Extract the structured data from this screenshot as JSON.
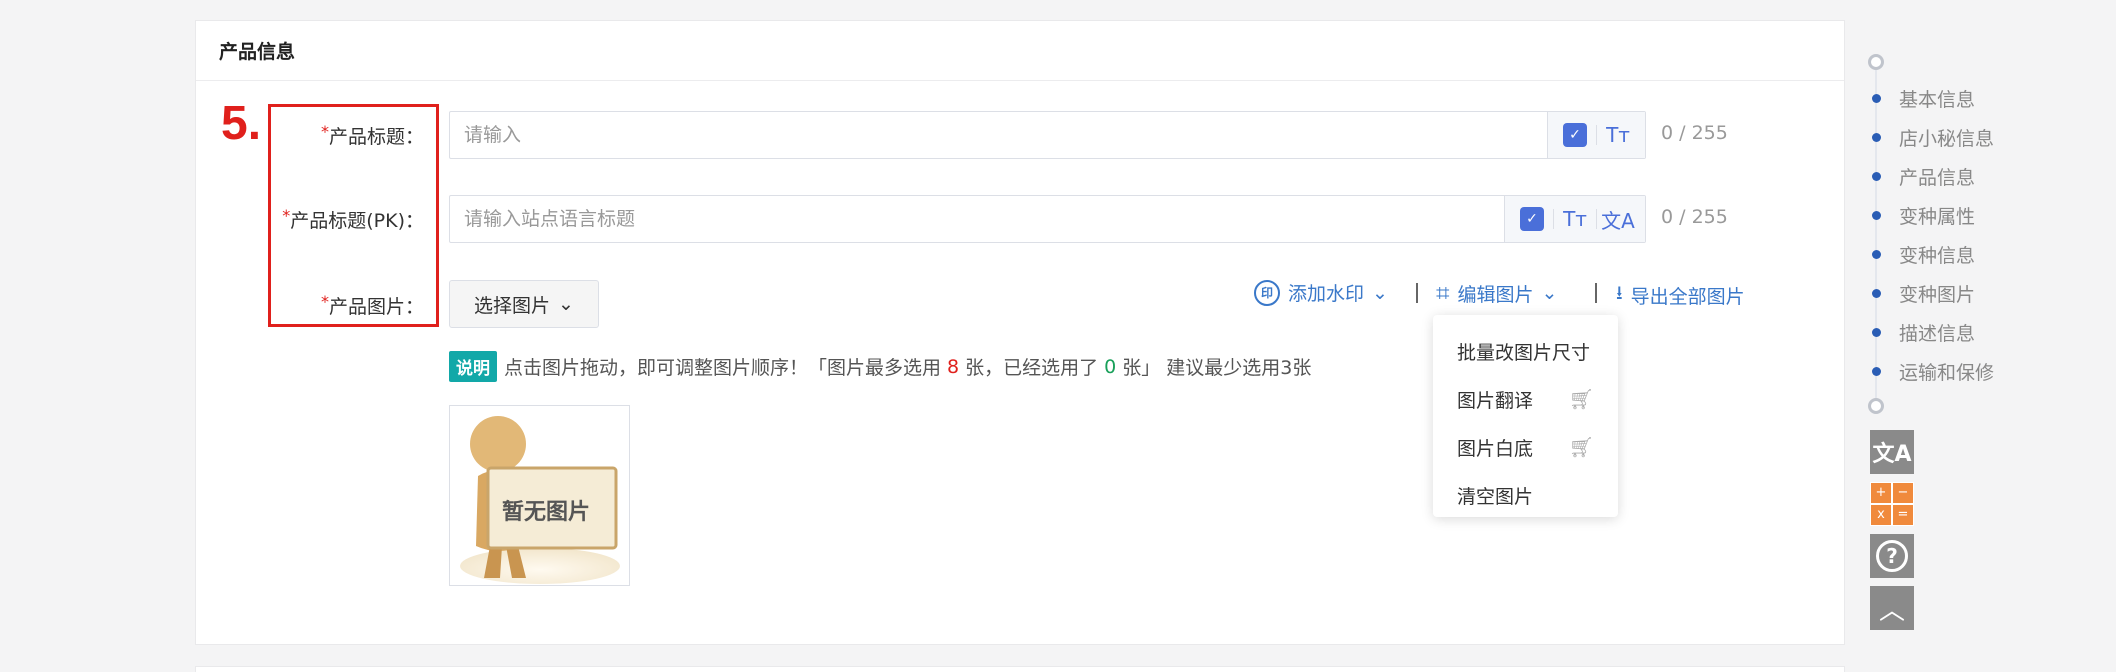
{
  "section": {
    "title": "产品信息"
  },
  "annotation": {
    "step": "5."
  },
  "fields": {
    "title": {
      "label": "产品标题：",
      "placeholder": "请输入",
      "counter": "0 / 255"
    },
    "title_pk": {
      "label": "产品标题(PK)：",
      "placeholder": "请输入站点语言标题",
      "counter": "0 / 255"
    },
    "images": {
      "label": "产品图片：",
      "select_button": "选择图片"
    }
  },
  "toolbar": {
    "watermark": "添加水印",
    "edit_images": "编辑图片",
    "export_all": "导出全部图片"
  },
  "edit_menu": {
    "items": [
      {
        "label": "批量改图片尺寸",
        "has_cart": false
      },
      {
        "label": "图片翻译",
        "has_cart": true
      },
      {
        "label": "图片白底",
        "has_cart": true
      },
      {
        "label": "清空图片",
        "has_cart": false
      }
    ]
  },
  "tip": {
    "tag": "说明",
    "text_a": "点击图片拖动，即可调整图片顺序！「图片最多选用",
    "max_count": "8",
    "text_b": "张，已经选用了",
    "used_count": "0",
    "text_c": "张」 建议最少选用3张"
  },
  "placeholder_image": {
    "caption": "暂无图片"
  },
  "anchor_nav": {
    "items": [
      "基本信息",
      "店小秘信息",
      "产品信息",
      "变种属性",
      "变种信息",
      "变种图片",
      "描述信息",
      "运输和保修"
    ]
  },
  "side_tools": {
    "calc_glyphs": [
      "+",
      "−",
      "x",
      "="
    ]
  },
  "colors": {
    "accent": "#3a78c9",
    "required": "#e0201c",
    "tag": "#12a8a8",
    "nav_dot": "#2a5db5"
  }
}
